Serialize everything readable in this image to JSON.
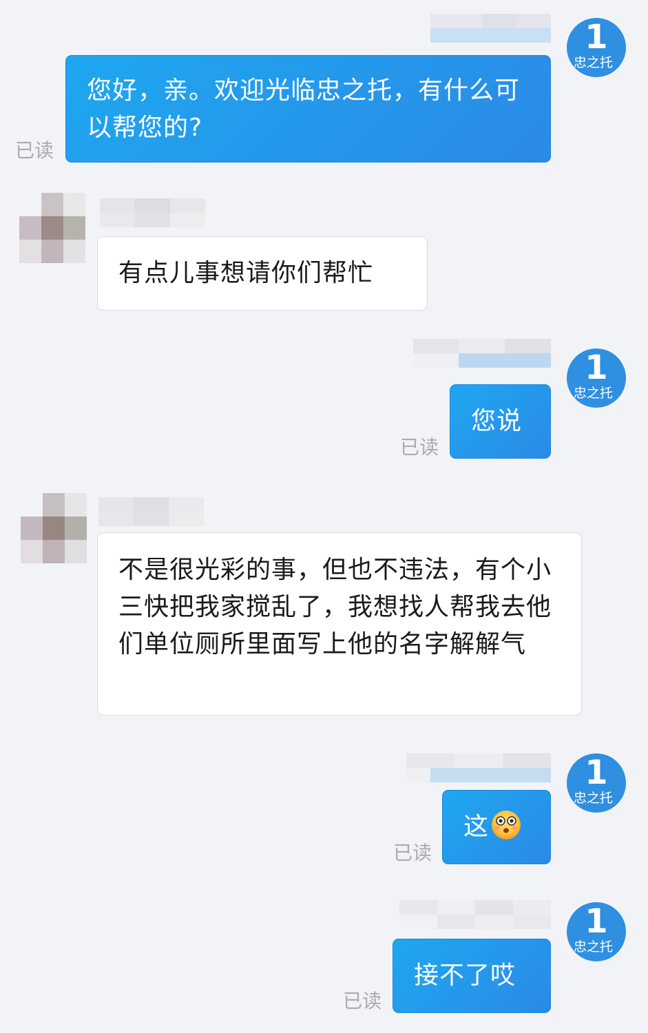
{
  "agent": {
    "avatar_number": "1",
    "avatar_brand": "忠之托"
  },
  "read_label": "已读",
  "messages": [
    {
      "direction": "out",
      "text": "您好，亲。欢迎光临忠之托，有什么可以帮您的?",
      "read": true
    },
    {
      "direction": "in",
      "text": "有点儿事想请你们帮忙"
    },
    {
      "direction": "out",
      "text": "您说",
      "read": true
    },
    {
      "direction": "in",
      "text": "不是很光彩的事，但也不违法，有个小三快把我家搅乱了，我想找人帮我去他们单位厕所里面写上他的名字解解气"
    },
    {
      "direction": "out",
      "text": "这",
      "emoji": "surprised-face-emoji",
      "read": true
    },
    {
      "direction": "out",
      "text": "接不了哎",
      "read": true
    }
  ],
  "colors": {
    "background": "#f2f3f7",
    "outgoing_bubble": "#2b8ae6",
    "incoming_bubble": "#ffffff",
    "avatar": "#2f8fe0",
    "read_text": "#a9abb0"
  }
}
